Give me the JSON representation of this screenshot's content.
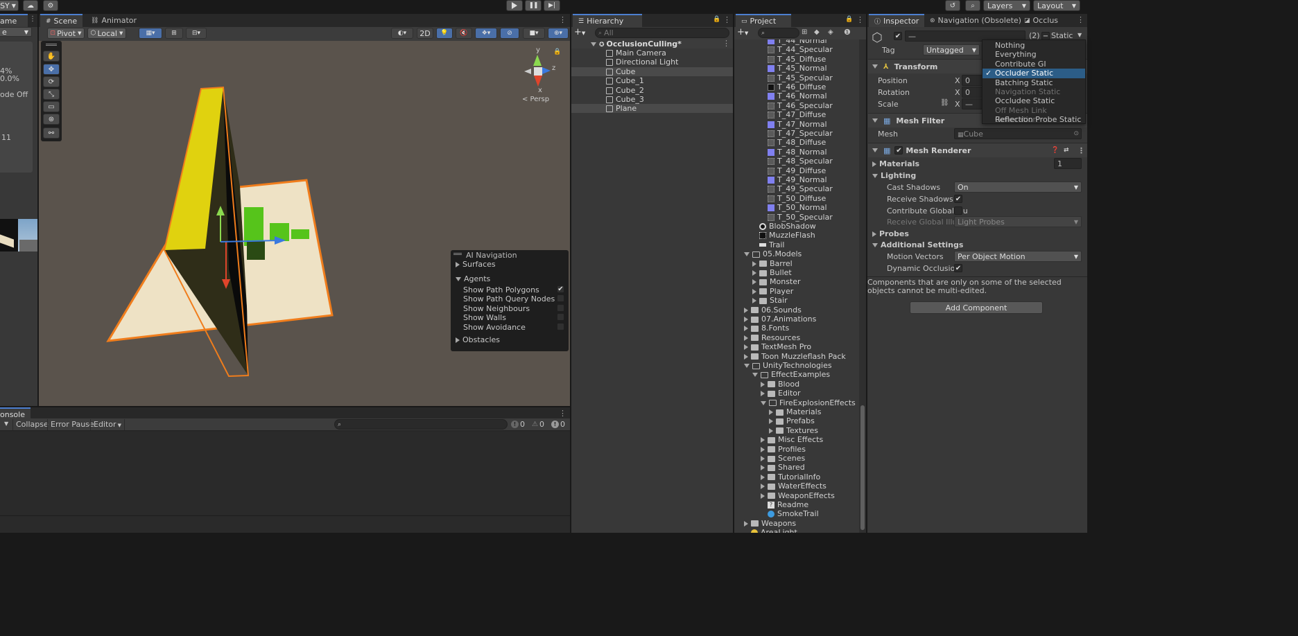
{
  "toolbar": {
    "account_label": "SY",
    "layers_label": "Layers",
    "layout_label": "Layout"
  },
  "left_panel": {
    "tab_label": "ame",
    "stat1": "4%",
    "stat2": "0.0%",
    "stat3": "ode Off",
    "stat4": "11"
  },
  "scene": {
    "tabs": [
      {
        "label": "Scene"
      },
      {
        "label": "Animator"
      }
    ],
    "pivot_label": "Pivot",
    "local_label": "Local",
    "mode_2d": "2D",
    "persp_label": "< Persp",
    "gizmo_y": "y",
    "gizmo_z": "z",
    "gizmo_x": "x"
  },
  "ai_navigation": {
    "title": "AI Navigation",
    "surfaces": "Surfaces",
    "agents": "Agents",
    "options": [
      {
        "label": "Show Path Polygons",
        "checked": true
      },
      {
        "label": "Show Path Query Nodes",
        "checked": false
      },
      {
        "label": "Show Neighbours",
        "checked": false
      },
      {
        "label": "Show Walls",
        "checked": false
      },
      {
        "label": "Show Avoidance",
        "checked": false
      }
    ],
    "obstacles": "Obstacles"
  },
  "console": {
    "tab_label": "onsole",
    "collapse": "Collapse",
    "error_pause": "Error Pause",
    "editor": "Editor",
    "count_info": "0",
    "count_warn": "0",
    "count_error": "0"
  },
  "hierarchy": {
    "tab_label": "Hierarchy",
    "search_placeholder": "All",
    "scene_name": "OcclusionCulling*",
    "items": [
      {
        "label": "Main Camera"
      },
      {
        "label": "Directional Light"
      },
      {
        "label": "Cube"
      },
      {
        "label": "Cube_1"
      },
      {
        "label": "Cube_2"
      },
      {
        "label": "Cube_3"
      },
      {
        "label": "Plane"
      }
    ]
  },
  "project": {
    "tab_label": "Project",
    "textures": [
      {
        "label": "T_44_Normal",
        "kind": "normal"
      },
      {
        "label": "T_44_Specular",
        "kind": "spec"
      },
      {
        "label": "T_45_Diffuse",
        "kind": "spec"
      },
      {
        "label": "T_45_Normal",
        "kind": "normal"
      },
      {
        "label": "T_45_Specular",
        "kind": "spec"
      },
      {
        "label": "T_46_Diffuse",
        "kind": "dark"
      },
      {
        "label": "T_46_Normal",
        "kind": "normal"
      },
      {
        "label": "T_46_Specular",
        "kind": "spec"
      },
      {
        "label": "T_47_Diffuse",
        "kind": "spec"
      },
      {
        "label": "T_47_Normal",
        "kind": "normal"
      },
      {
        "label": "T_47_Specular",
        "kind": "spec"
      },
      {
        "label": "T_48_Diffuse",
        "kind": "spec"
      },
      {
        "label": "T_48_Normal",
        "kind": "normal"
      },
      {
        "label": "T_48_Specular",
        "kind": "spec"
      },
      {
        "label": "T_49_Diffuse",
        "kind": "spec"
      },
      {
        "label": "T_49_Normal",
        "kind": "normal"
      },
      {
        "label": "T_49_Specular",
        "kind": "spec"
      },
      {
        "label": "T_50_Diffuse",
        "kind": "spec"
      },
      {
        "label": "T_50_Normal",
        "kind": "normal"
      },
      {
        "label": "T_50_Specular",
        "kind": "spec"
      }
    ],
    "assets": [
      {
        "label": "BlobShadow"
      },
      {
        "label": "MuzzleFlash"
      },
      {
        "label": "Trail"
      }
    ],
    "models_folder": "05.Models",
    "models": [
      {
        "label": "Barrel"
      },
      {
        "label": "Bullet"
      },
      {
        "label": "Monster"
      },
      {
        "label": "Player"
      },
      {
        "label": "Stair"
      }
    ],
    "root_folders": [
      {
        "label": "06.Sounds"
      },
      {
        "label": "07.Animations"
      },
      {
        "label": "8.Fonts"
      },
      {
        "label": "Resources"
      },
      {
        "label": "TextMesh Pro"
      },
      {
        "label": "Toon Muzzleflash Pack"
      }
    ],
    "unity_folder": "UnityTechnologies",
    "effect_examples": "EffectExamples",
    "ee_children": [
      {
        "label": "Blood"
      },
      {
        "label": "Editor"
      }
    ],
    "fire_folder": "FireExplosionEffects",
    "fire_children": [
      {
        "label": "Materials"
      },
      {
        "label": "Prefabs"
      },
      {
        "label": "Textures"
      }
    ],
    "ee_children2": [
      {
        "label": "Misc Effects"
      },
      {
        "label": "Profiles"
      },
      {
        "label": "Scenes"
      },
      {
        "label": "Shared"
      },
      {
        "label": "TutorialInfo"
      },
      {
        "label": "WaterEffects"
      },
      {
        "label": "WeaponEffects"
      }
    ],
    "readme": "Readme",
    "smoketrail": "SmokeTrail",
    "weapons": "Weapons",
    "arealight": "AreaLight"
  },
  "inspector": {
    "tabs": [
      {
        "label": "Inspector"
      },
      {
        "label": "Navigation (Obsolete)"
      },
      {
        "label": "Occlus"
      }
    ],
    "object_name": "—",
    "count": "(2)",
    "static_label": "Static",
    "tag_label": "Tag",
    "tag_value": "Untagged",
    "transform": {
      "title": "Transform",
      "position": "Position",
      "rotation": "Rotation",
      "scale": "Scale",
      "x_label": "X",
      "pos_x": "0",
      "rot_x": "0",
      "scale_x": "—"
    },
    "mesh_filter": {
      "title": "Mesh Filter",
      "mesh_label": "Mesh",
      "mesh_value": "Cube"
    },
    "mesh_renderer": {
      "title": "Mesh Renderer",
      "materials": "Materials",
      "materials_count": "1",
      "lighting": "Lighting",
      "cast_shadows": "Cast Shadows",
      "cast_shadows_value": "On",
      "receive_shadows": "Receive Shadows",
      "contribute_gi": "Contribute Global Illu",
      "receive_gi": "Receive Global Illum",
      "receive_gi_value": "Light Probes",
      "probes": "Probes",
      "additional_settings": "Additional Settings",
      "motion_vectors": "Motion Vectors",
      "motion_vectors_value": "Per Object Motion",
      "dynamic_occlusion": "Dynamic Occlusion"
    },
    "multi_edit_note": "Components that are only on some of the selected objects cannot be multi-edited.",
    "add_component": "Add Component"
  },
  "static_menu": {
    "items": [
      {
        "label": "Nothing",
        "state": "normal"
      },
      {
        "label": "Everything",
        "state": "normal"
      },
      {
        "label": "Contribute GI",
        "state": "normal"
      },
      {
        "label": "Occluder Static",
        "state": "selected"
      },
      {
        "label": "Batching Static",
        "state": "normal"
      },
      {
        "label": "Navigation Static",
        "state": "disabled"
      },
      {
        "label": "Occludee Static",
        "state": "normal"
      },
      {
        "label": "Off Mesh Link Generation",
        "state": "disabled"
      },
      {
        "label": "Reflection Probe Static",
        "state": "normal"
      }
    ]
  }
}
